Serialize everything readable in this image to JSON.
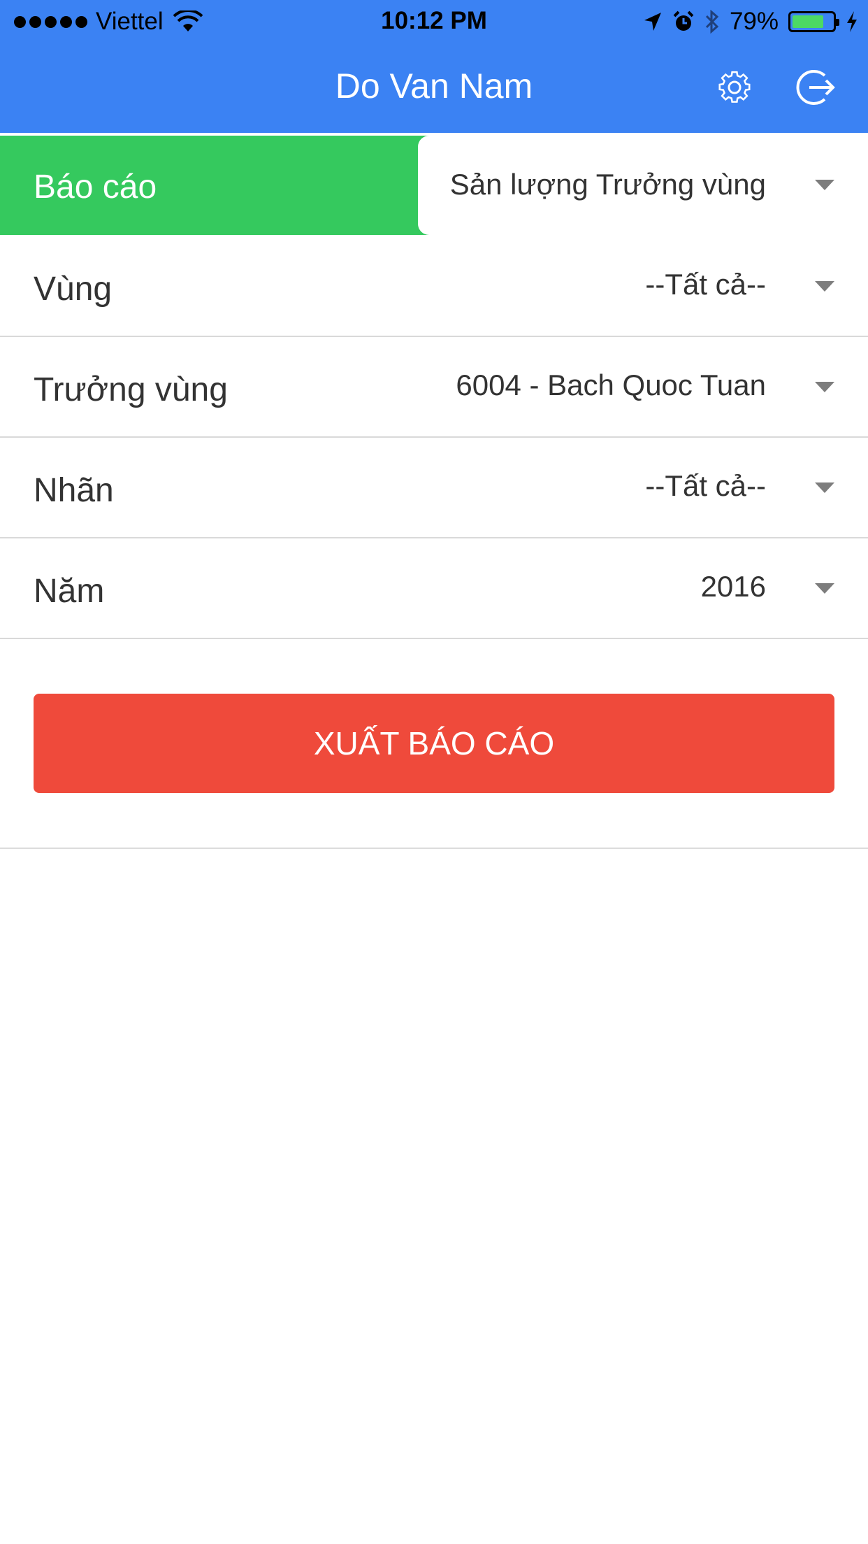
{
  "status_bar": {
    "carrier": "Viettel",
    "time": "10:12 PM",
    "battery": "79%",
    "battery_level": 0.79,
    "icons": [
      "signal-icon",
      "wifi-icon",
      "location-arrow-icon",
      "alarm-icon",
      "bluetooth-icon",
      "battery-icon",
      "charging-bolt-icon"
    ]
  },
  "header": {
    "title": "Do Van Nam",
    "settings_icon": "gear-icon",
    "logout_icon": "logout-icon"
  },
  "report": {
    "label": "Báo cáo",
    "selected": "Sản lượng Trưởng vùng"
  },
  "filters": [
    {
      "label": "Vùng",
      "value": "--Tất cả--"
    },
    {
      "label": "Trưởng vùng",
      "value": "6004 - Bach Quoc Tuan"
    },
    {
      "label": "Nhãn",
      "value": "--Tất cả--"
    },
    {
      "label": "Năm",
      "value": "2016"
    }
  ],
  "export_button": "XUẤT BÁO CÁO",
  "colors": {
    "header": "#3b82f3",
    "report_label_bg": "#35c95e",
    "export_button": "#ef4a3b",
    "battery_fill": "#4cd964"
  }
}
